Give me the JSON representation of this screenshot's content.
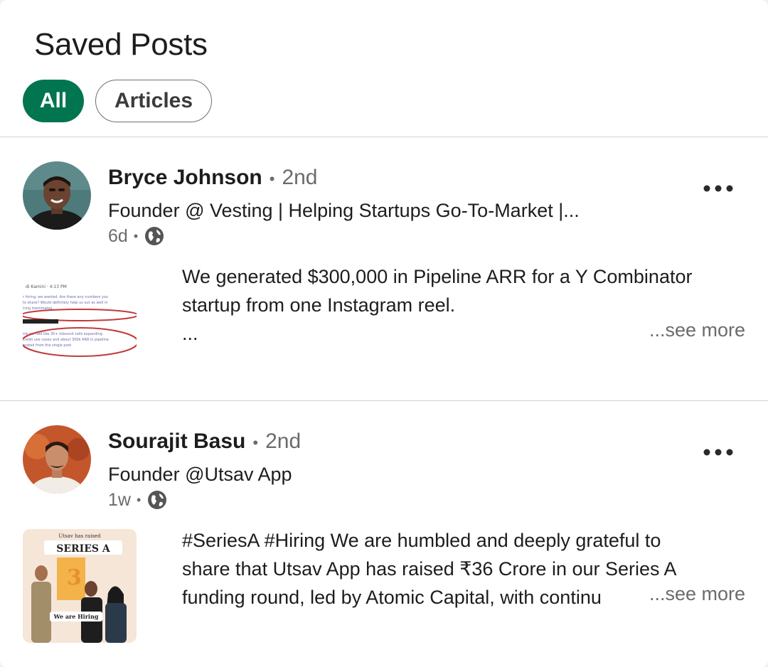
{
  "page": {
    "title": "Saved Posts"
  },
  "filters": [
    {
      "label": "All",
      "active": true
    },
    {
      "label": "Articles",
      "active": false
    }
  ],
  "posts": [
    {
      "author": "Bryce Johnson",
      "separator": "•",
      "degree": "2nd",
      "headline": "Founder @ Vesting | Helping Startups Go-To-Market |...",
      "time": "6d",
      "visibility_icon": "globe-icon",
      "body_lines": [
        "We generated $300,000 in Pipeline ARR for a Y Combinator",
        "startup from one Instagram reel.",
        "..."
      ],
      "see_more": "...see more",
      "thumbnail_text": {
        "header": "di Kamini · 4:13 PM",
        "line1": "r hiring, we wanted. Are there any numbers you",
        "line2": "to share? Would definitely help us out as well in",
        "line3": "iring teammates.",
        "line4": "ink we had like 30+ inbound calls expanding",
        "line5": "credit use cases and about 300k ARR in pipeline",
        "line6": "erated from the single post"
      }
    },
    {
      "author": "Sourajit Basu",
      "separator": "•",
      "degree": "2nd",
      "headline": "Founder @Utsav App",
      "time": "1w",
      "visibility_icon": "globe-icon",
      "body_lines": [
        "#SeriesA #Hiring We are humbled and deeply grateful to",
        "share that Utsav App has raised ₹36 Crore in our Series A",
        "funding round, led by Atomic Capital, with continu"
      ],
      "see_more": "...see more",
      "thumbnail_text": {
        "top": "Utsav has raised",
        "banner": "SERIES A",
        "bottom": "We are Hiring"
      }
    }
  ],
  "colors": {
    "accent": "#01754f",
    "muted": "#6b6b6b",
    "divider": "#d6d3cd"
  }
}
